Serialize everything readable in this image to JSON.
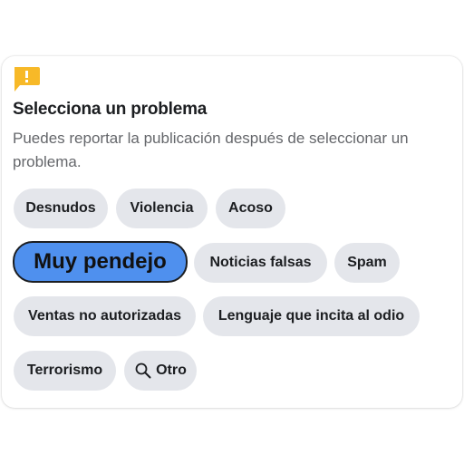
{
  "dialog": {
    "title": "Selecciona un problema",
    "subtitle": "Puedes reportar la publicación después de seleccionar un problema."
  },
  "icons": {
    "header": "flag-icon",
    "other": "search-icon"
  },
  "colors": {
    "flag": "#f7b928",
    "chip_background": "#e4e6eb",
    "selected_background": "#4f90ee",
    "text_primary": "#1c1e21",
    "text_secondary": "#65676b"
  },
  "options": [
    {
      "label": "Desnudos",
      "selected": false
    },
    {
      "label": "Violencia",
      "selected": false
    },
    {
      "label": "Acoso",
      "selected": false
    },
    {
      "label": "Muy pendejo",
      "selected": true
    },
    {
      "label": "Noticias falsas",
      "selected": false
    },
    {
      "label": "Spam",
      "selected": false
    },
    {
      "label": "Ventas no autorizadas",
      "selected": false
    },
    {
      "label": "Lenguaje que incita al odio",
      "selected": false
    },
    {
      "label": "Terrorismo",
      "selected": false
    },
    {
      "label": "Otro",
      "selected": false
    }
  ]
}
